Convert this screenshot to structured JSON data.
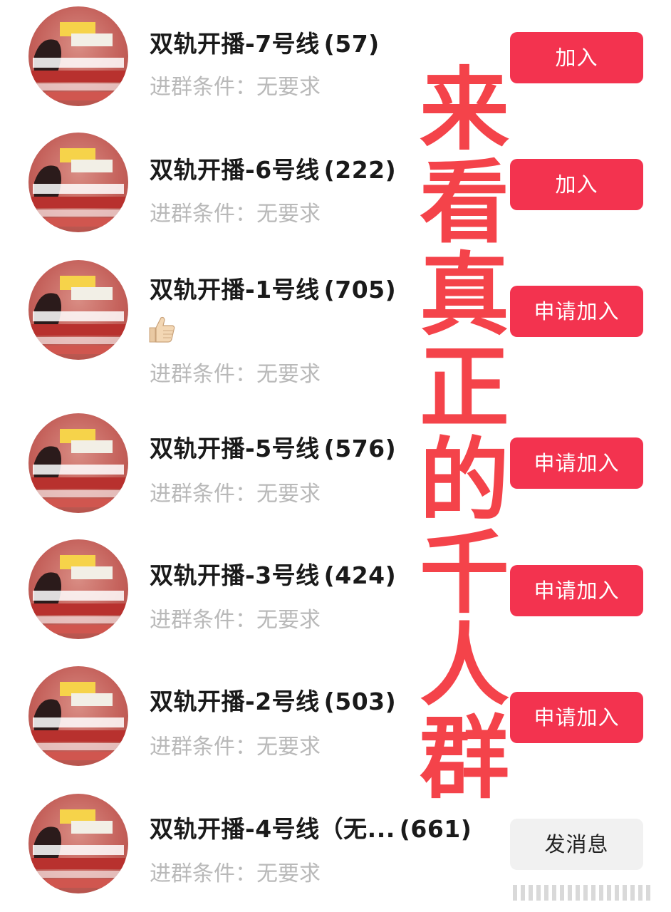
{
  "groups": [
    {
      "name": "双轨开播-7号线",
      "count": "(57)",
      "condition": "进群条件：无要求",
      "action": "加入",
      "action_style": "primary",
      "has_emoji": false
    },
    {
      "name": "双轨开播-6号线",
      "count": "(222)",
      "condition": "进群条件：无要求",
      "action": "加入",
      "action_style": "primary",
      "has_emoji": false
    },
    {
      "name": "双轨开播-1号线",
      "count": "(705)",
      "condition": "进群条件：无要求",
      "action": "申请加入",
      "action_style": "primary",
      "has_emoji": true
    },
    {
      "name": "双轨开播-5号线",
      "count": "(576)",
      "condition": "进群条件：无要求",
      "action": "申请加入",
      "action_style": "primary",
      "has_emoji": false
    },
    {
      "name": "双轨开播-3号线",
      "count": "(424)",
      "condition": "进群条件：无要求",
      "action": "申请加入",
      "action_style": "primary",
      "has_emoji": false
    },
    {
      "name": "双轨开播-2号线",
      "count": "(503)",
      "condition": "进群条件：无要求",
      "action": "申请加入",
      "action_style": "primary",
      "has_emoji": false
    },
    {
      "name": "双轨开播-4号线（无...",
      "count": "(661)",
      "condition": "进群条件：无要求",
      "action": "发消息",
      "action_style": "secondary",
      "has_emoji": false
    }
  ],
  "overlay_text": [
    "来",
    "看",
    "真",
    "正",
    "的",
    "千",
    "人",
    "群"
  ],
  "emoji_icon": "thumbs-up",
  "colors": {
    "primary_button": "#f3334f",
    "secondary_button": "#f1f1f1",
    "overlay_text": "#f4434a",
    "condition_text": "#b9b9b9"
  }
}
